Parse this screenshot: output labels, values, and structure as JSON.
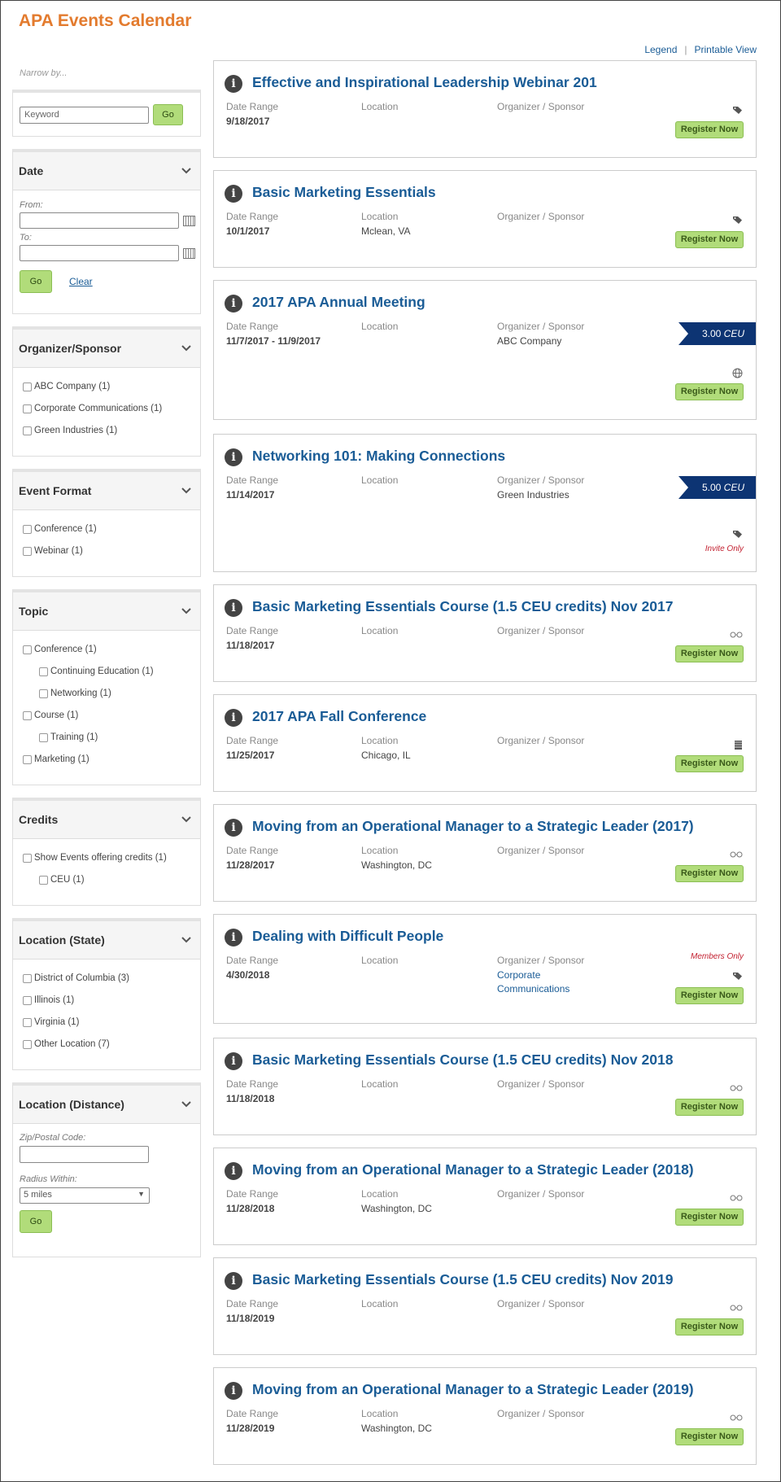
{
  "header": {
    "title": "APA Events Calendar",
    "legend": "Legend",
    "printable": "Printable View"
  },
  "sidebar": {
    "narrow": "Narrow by...",
    "keyword": {
      "placeholder": "Keyword",
      "go": "Go"
    },
    "date": {
      "title": "Date",
      "from": "From:",
      "to": "To:",
      "go": "Go",
      "clear": "Clear"
    },
    "organizer": {
      "title": "Organizer/Sponsor",
      "items": [
        "ABC Company (1)",
        "Corporate Communications (1)",
        "Green Industries (1)"
      ]
    },
    "format": {
      "title": "Event Format",
      "items": [
        "Conference (1)",
        "Webinar (1)"
      ]
    },
    "topic": {
      "title": "Topic",
      "items": [
        "Conference (1)",
        "Continuing Education (1)",
        "Networking (1)",
        "Course (1)",
        "Training (1)",
        "Marketing (1)"
      ]
    },
    "credits": {
      "title": "Credits",
      "items": [
        "Show Events offering credits (1)",
        "CEU (1)"
      ]
    },
    "state": {
      "title": "Location (State)",
      "items": [
        "District of Columbia (3)",
        "Illinois (1)",
        "Virginia (1)",
        "Other Location (7)"
      ]
    },
    "distance": {
      "title": "Location (Distance)",
      "zip": "Zip/Postal Code:",
      "radius": "Radius Within:",
      "radius_value": "5 miles",
      "go": "Go"
    }
  },
  "labels": {
    "date": "Date Range",
    "location": "Location",
    "org": "Organizer / Sponsor",
    "register": "Register Now",
    "ceu_unit": "CEU"
  },
  "events": [
    {
      "title": "Effective and Inspirational Leadership Webinar 201",
      "date": "9/18/2017",
      "location": "",
      "org": "",
      "icon": "tag-icon"
    },
    {
      "title": "Basic Marketing Essentials",
      "date": "10/1/2017",
      "location": "Mclean, VA",
      "org": "",
      "icon": "tag-icon"
    },
    {
      "title": "2017 APA Annual Meeting",
      "date": "11/7/2017 - 11/9/2017",
      "location": "",
      "org": "ABC Company",
      "icon": "globe-icon",
      "ceu": "3.00"
    },
    {
      "title": "Networking 101: Making Connections",
      "date": "11/14/2017",
      "location": "",
      "org": "Green Industries",
      "icon": "tag-icon",
      "ceu": "5.00",
      "note": "Invite Only"
    },
    {
      "title": "Basic Marketing Essentials Course (1.5 CEU credits) Nov 2017",
      "date": "11/18/2017",
      "location": "",
      "org": "",
      "icon": "glasses-icon"
    },
    {
      "title": "2017 APA Fall Conference",
      "date": "11/25/2017",
      "location": "Chicago, IL",
      "org": "",
      "icon": "notebook-icon"
    },
    {
      "title": "Moving from an Operational Manager to a Strategic Leader (2017)",
      "date": "11/28/2017",
      "location": "Washington, DC",
      "org": "",
      "icon": "glasses-icon"
    },
    {
      "title": "Dealing with Difficult People",
      "date": "4/30/2018",
      "location": "",
      "org": "Corporate Communications",
      "icon": "tag-icon",
      "note_top": "Members Only"
    },
    {
      "title": "Basic Marketing Essentials Course (1.5 CEU credits) Nov 2018",
      "date": "11/18/2018",
      "location": "",
      "org": "",
      "icon": "glasses-icon"
    },
    {
      "title": "Moving from an Operational Manager to a Strategic Leader (2018)",
      "date": "11/28/2018",
      "location": "Washington, DC",
      "org": "",
      "icon": "glasses-icon"
    },
    {
      "title": "Basic Marketing Essentials Course (1.5 CEU credits) Nov 2019",
      "date": "11/18/2019",
      "location": "",
      "org": "",
      "icon": "glasses-icon"
    },
    {
      "title": "Moving from an Operational Manager to a Strategic Leader (2019)",
      "date": "11/28/2019",
      "location": "Washington, DC",
      "org": "",
      "icon": "glasses-icon"
    }
  ]
}
